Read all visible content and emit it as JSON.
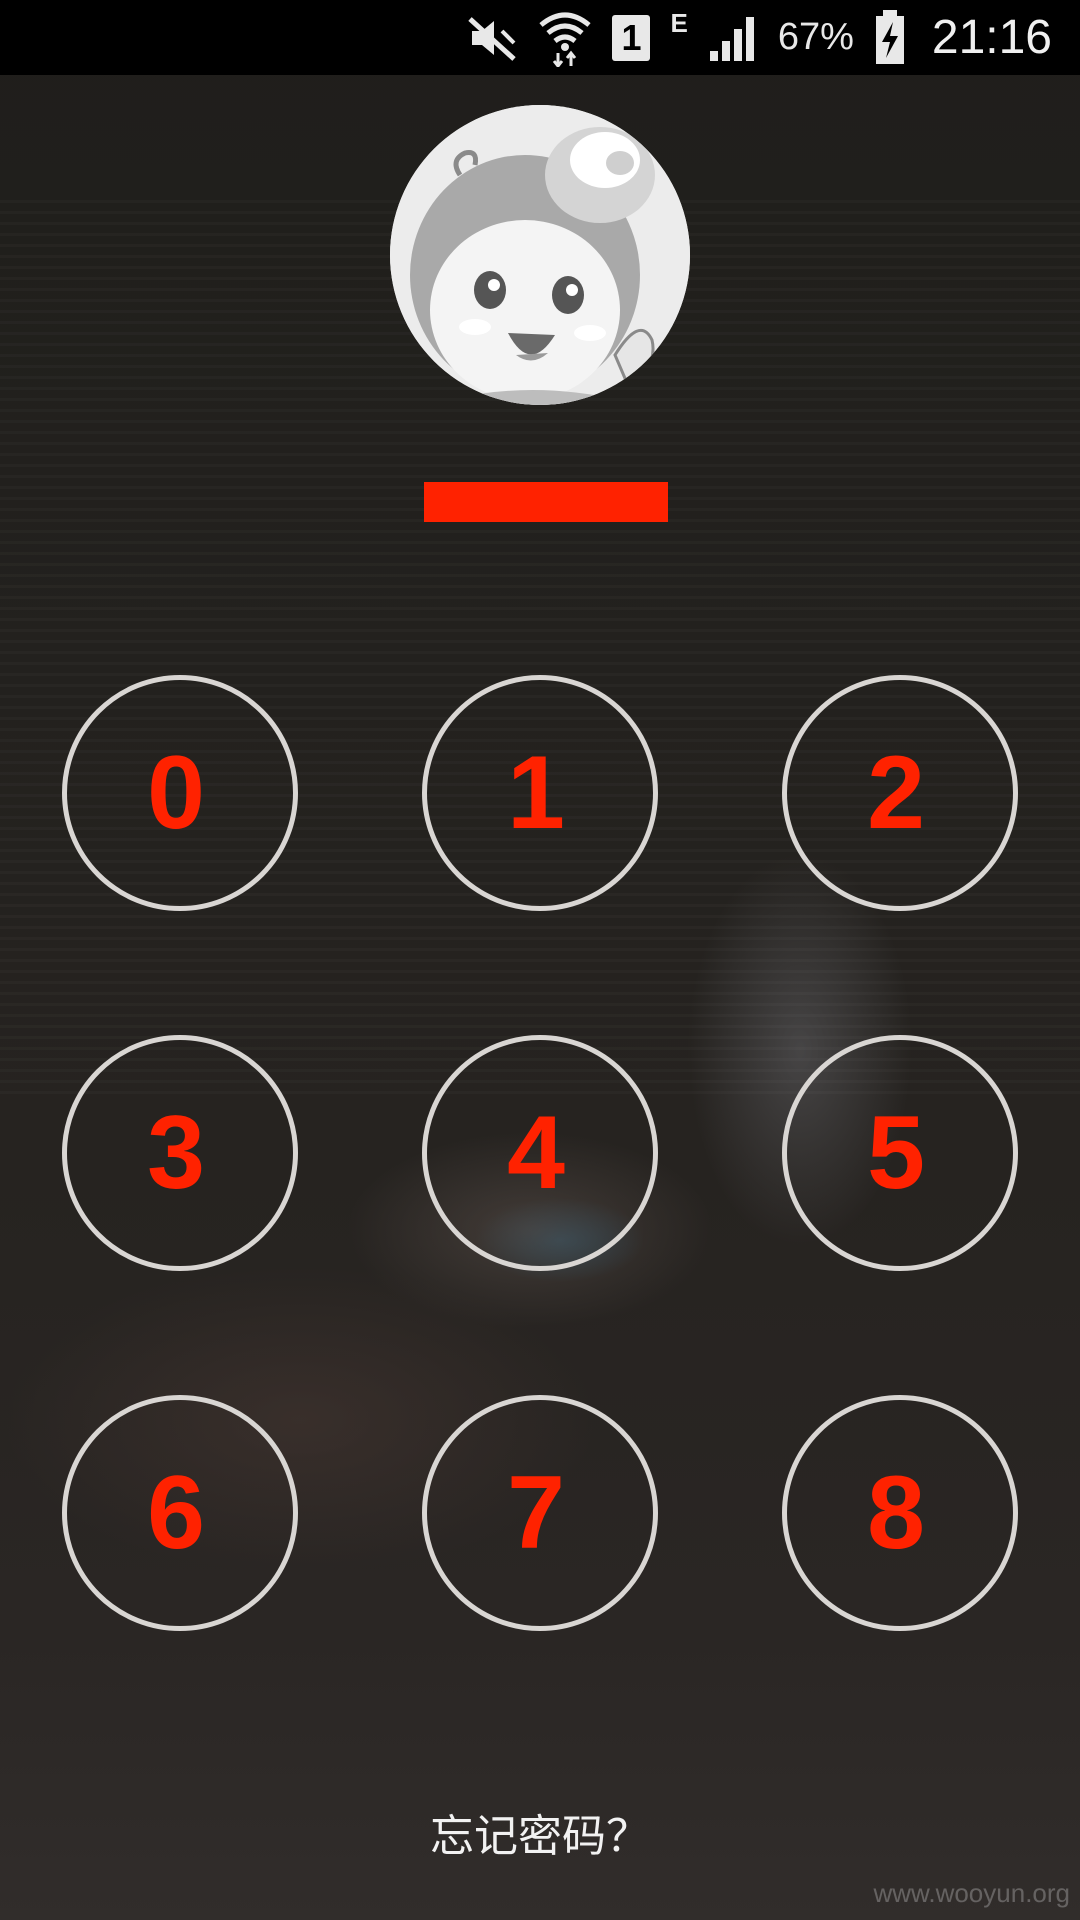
{
  "status_bar": {
    "icons": [
      "mute-icon",
      "wifi-icon",
      "sim-1-icon",
      "network-e-icon",
      "signal-icon",
      "battery-charging-icon"
    ],
    "sim_label": "1",
    "network_type": "E",
    "battery": "67%",
    "time": "21:16"
  },
  "account": {
    "avatar": "cartoon-avatar",
    "username_redacted": true,
    "username_color": "#ff2200"
  },
  "keypad": {
    "keys": [
      "0",
      "1",
      "2",
      "3",
      "4",
      "5",
      "6",
      "7",
      "8"
    ],
    "digit_color": "#ff2200"
  },
  "forgot_password": "忘记密码？",
  "watermark": "www.wooyun.org"
}
